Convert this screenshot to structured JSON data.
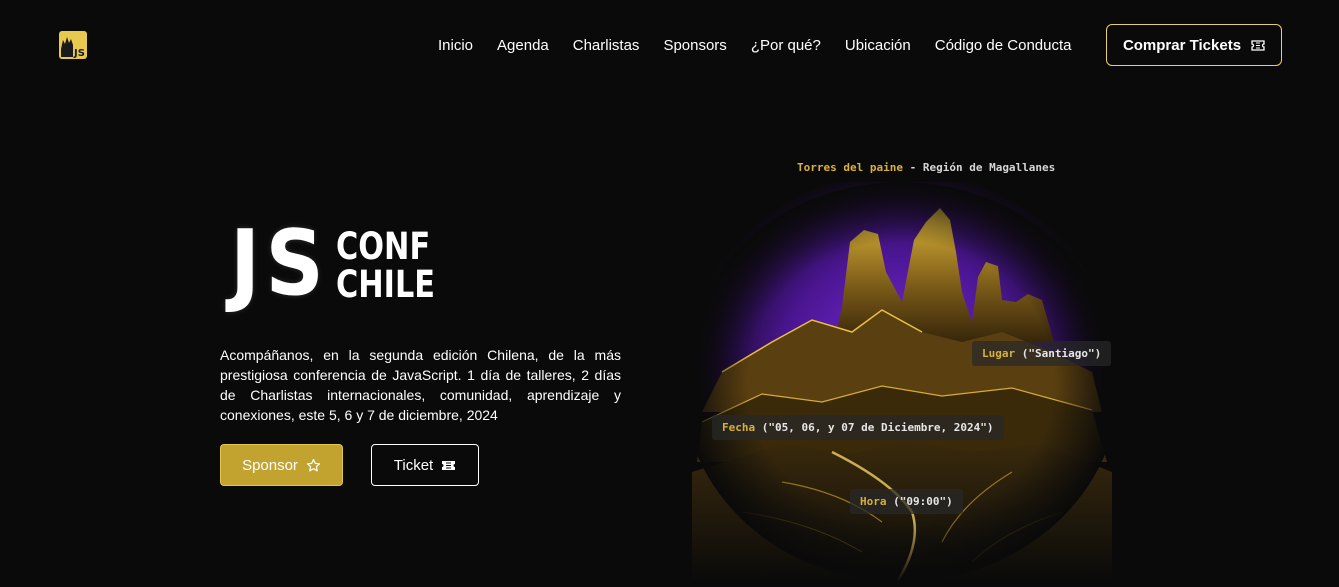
{
  "header": {
    "logo_text": "JS",
    "nav": [
      "Inicio",
      "Agenda",
      "Charlistas",
      "Sponsors",
      "¿Por qué?",
      "Ubicación",
      "Código de Conducta"
    ],
    "cta_label": "Comprar Tickets",
    "cta_icon": "ticket-icon"
  },
  "hero": {
    "brand_js": "JS",
    "brand_line1": "CONF",
    "brand_line2": "CHILE",
    "description": "Acompáñanos, en la segunda edición Chilena, de la más prestigiosa conferencia de JavaScript. 1 día de talleres, 2 días de Charlistas internacionales, comunidad, aprendizaje y conexiones, este 5, 6 y 7 de diciembre, 2024",
    "sponsor_label": "Sponsor",
    "sponsor_icon": "star-icon",
    "ticket_label": "Ticket",
    "ticket_icon": "ticket-icon"
  },
  "artwork": {
    "caption_place": "Torres del paine",
    "caption_sep": " - ",
    "caption_region": "Región de Magallanes",
    "tags": [
      {
        "key": "Lugar",
        "value": " (\"Santiago\")"
      },
      {
        "key": "Fecha",
        "value": " (\"05, 06, y 07 de Diciembre, 2024\")"
      },
      {
        "key": "Hora",
        "value": " (\"09:00\")"
      }
    ]
  },
  "colors": {
    "background": "#0a0a0a",
    "accent_gold": "#c2a32f",
    "accent_border": "#e9cf6a",
    "artwork_purple": "#6a1fc2"
  }
}
